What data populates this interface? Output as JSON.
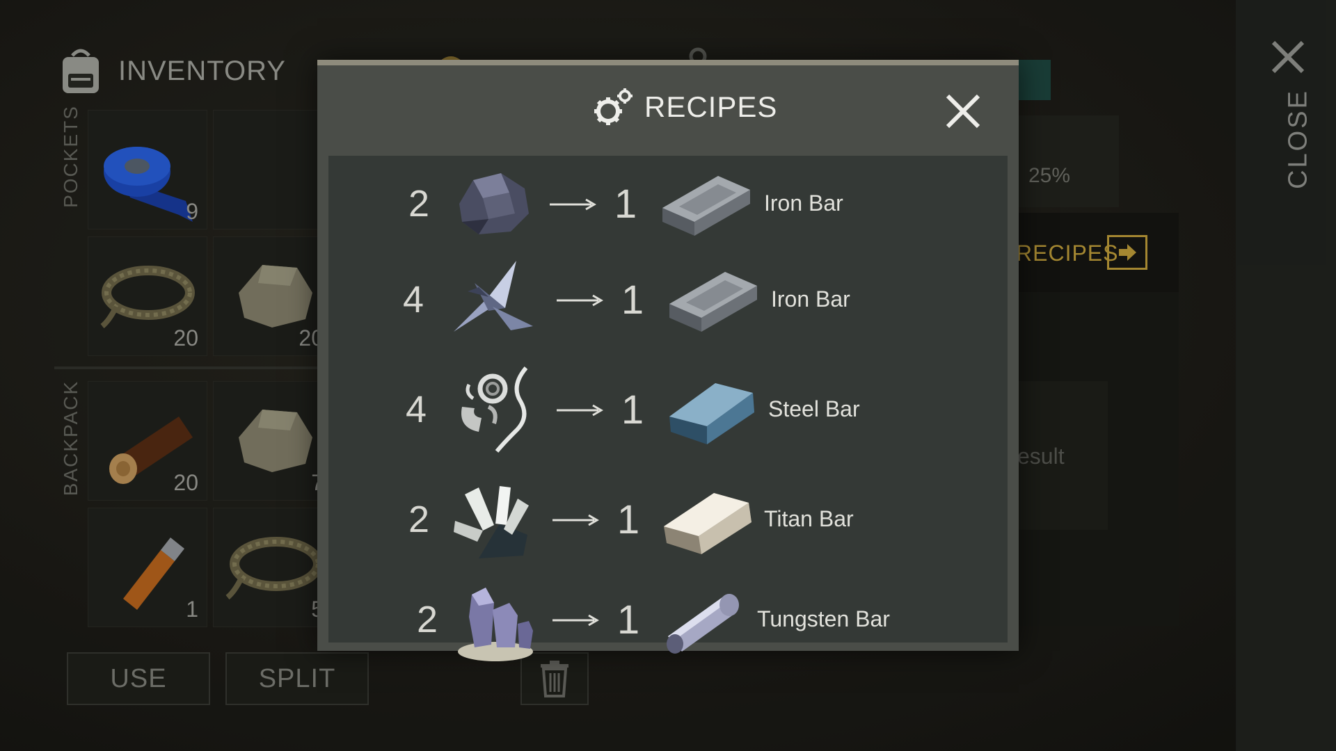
{
  "inventory": {
    "title": "INVENTORY",
    "sections": {
      "pockets": "POCKETS",
      "backpack": "BACKPACK"
    },
    "slots": [
      {
        "item": "duct-tape",
        "count": "9"
      },
      {
        "item": "empty",
        "count": ""
      },
      {
        "item": "rope",
        "count": "20"
      },
      {
        "item": "stone",
        "count": "20"
      },
      {
        "item": "log",
        "count": "20"
      },
      {
        "item": "stone",
        "count": "7"
      },
      {
        "item": "usb-drive",
        "count": "1"
      },
      {
        "item": "rope",
        "count": "5"
      }
    ],
    "buttons": {
      "use": "USE",
      "split": "SPLIT"
    }
  },
  "right_panel": {
    "chance_text": "25%",
    "recipes_link": "RECIPES",
    "result_text": "esult"
  },
  "close_label": "CLOSE",
  "modal": {
    "title": "RECIPES",
    "recipes": [
      {
        "qty_in": "2",
        "ingredient": "iron-ore",
        "qty_out": "1",
        "product": "Iron Bar"
      },
      {
        "qty_in": "4",
        "ingredient": "scrap-metal",
        "qty_out": "1",
        "product": "Iron Bar"
      },
      {
        "qty_in": "4",
        "ingredient": "metal-shavings",
        "qty_out": "1",
        "product": "Steel Bar"
      },
      {
        "qty_in": "2",
        "ingredient": "titanium-crystals",
        "qty_out": "1",
        "product": "Titan Bar"
      },
      {
        "qty_in": "2",
        "ingredient": "tungsten-crystals",
        "qty_out": "1",
        "product": "Tungsten Bar"
      }
    ]
  },
  "colors": {
    "accent_gold": "#c9a53c",
    "modal_bg": "#4a4d48",
    "list_bg": "#343936",
    "teal": "#1f4a42"
  }
}
